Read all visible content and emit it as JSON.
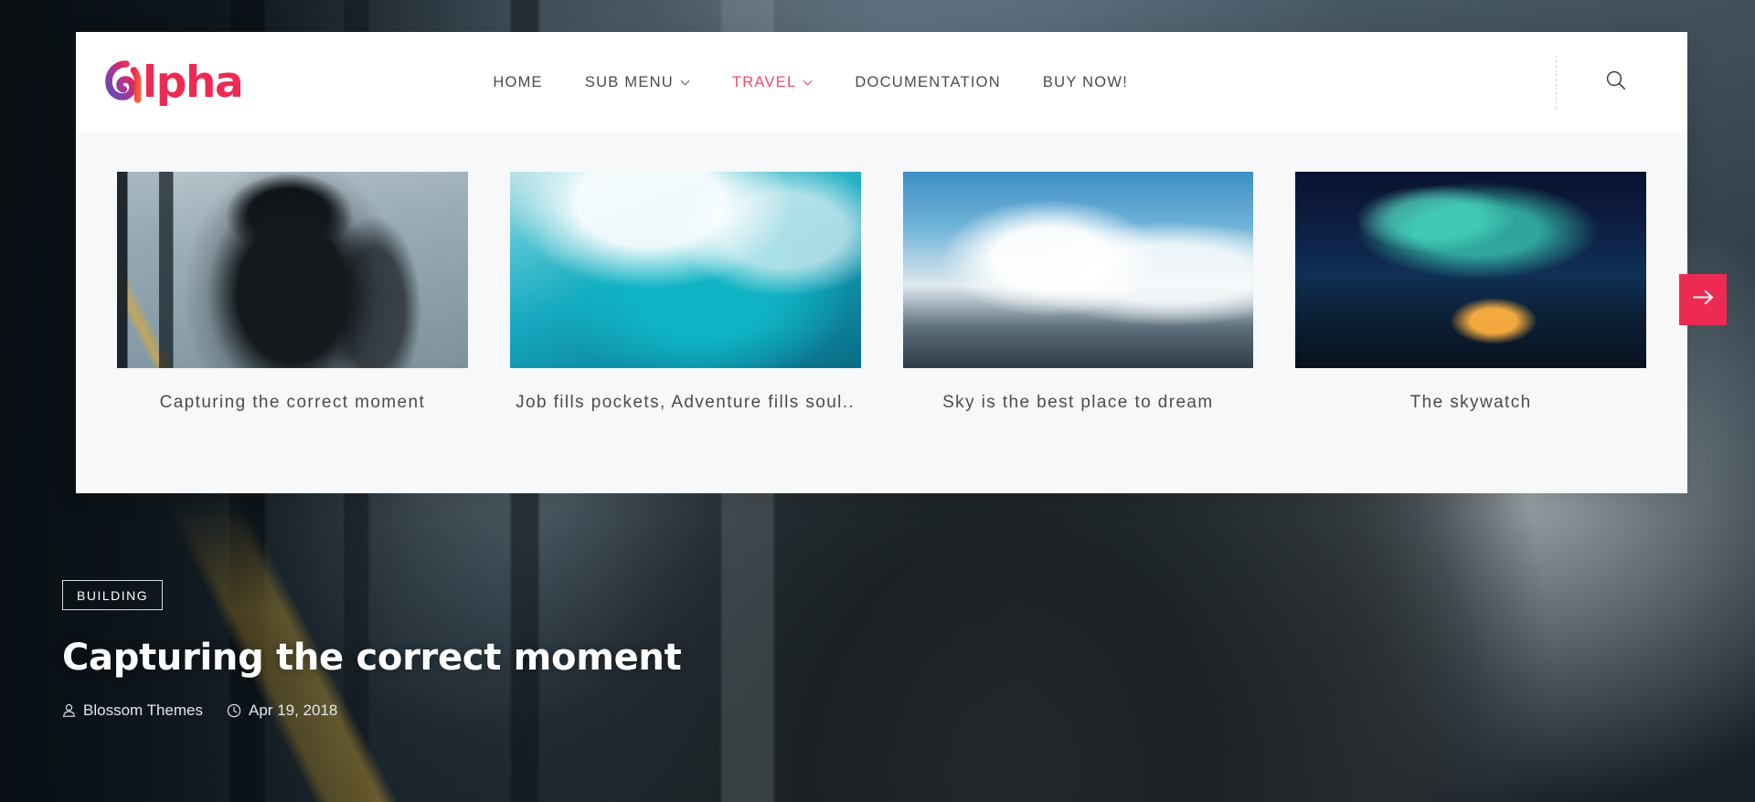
{
  "site": {
    "logo_word": "lpha",
    "logo_full": "Alpha",
    "logo_icon": "alpha-swirl-logo"
  },
  "nav": {
    "items": [
      {
        "label": "HOME",
        "has_dropdown": false,
        "active": false
      },
      {
        "label": "SUB MENU",
        "has_dropdown": true,
        "active": false
      },
      {
        "label": "TRAVEL",
        "has_dropdown": true,
        "active": true
      },
      {
        "label": "DOCUMENTATION",
        "has_dropdown": false,
        "active": false
      },
      {
        "label": "BUY NOW!",
        "has_dropdown": false,
        "active": false
      }
    ],
    "search_icon": "search-icon"
  },
  "carousel": {
    "next_icon": "arrow-right-icon",
    "slides": [
      {
        "title": "Capturing the correct moment",
        "image": "photographer-in-station"
      },
      {
        "title": "Job fills pockets, Adventure fills soul..",
        "image": "ocean-wave-surfer"
      },
      {
        "title": "Sky is the best place to dream",
        "image": "mountain-peak-clouds"
      },
      {
        "title": "The skywatch",
        "image": "aurora-over-cabin"
      }
    ]
  },
  "hero": {
    "category": "BUILDING",
    "title": "Capturing the correct moment",
    "author": "Blossom Themes",
    "author_icon": "user-icon",
    "date": "Apr 19, 2018",
    "date_icon": "clock-icon"
  },
  "colors": {
    "accent": "#ed2a52",
    "nav_active": "#f2496b",
    "panel_bg": "#ffffff",
    "carousel_bg": "#f7f8fa",
    "nav_text": "#4a4a4a"
  }
}
